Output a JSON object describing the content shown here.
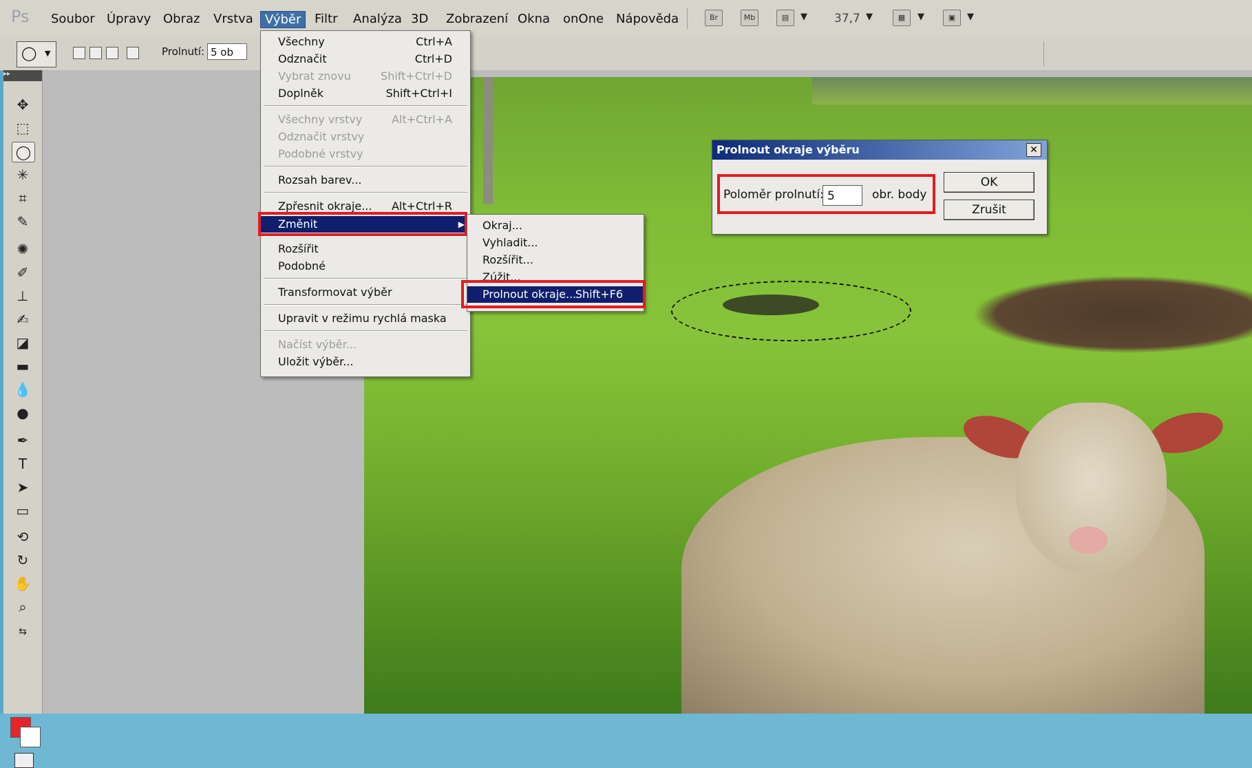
{
  "app": {
    "logo": "Ps"
  },
  "menubar": {
    "items": [
      "Soubor",
      "Úpravy",
      "Obraz",
      "Vrstva",
      "Výběr",
      "Filtr",
      "Analýza",
      "3D",
      "Zobrazení",
      "Okna",
      "onOne",
      "Nápověda"
    ],
    "active": "Výběr",
    "icons": [
      "Br",
      "Mb"
    ],
    "zoom": "37,7"
  },
  "options": {
    "feather_label": "Prolnutí:",
    "feather_value": "5 ob"
  },
  "menu": {
    "items": [
      {
        "label": "Všechny",
        "shortcut": "Ctrl+A"
      },
      {
        "label": "Odznačit",
        "shortcut": "Ctrl+D"
      },
      {
        "label": "Vybrat znovu",
        "shortcut": "Shift+Ctrl+D"
      },
      {
        "label": "Doplněk",
        "shortcut": "Shift+Ctrl+I"
      },
      {
        "label": "Všechny vrstvy",
        "shortcut": "Alt+Ctrl+A"
      },
      {
        "label": "Odznačit vrstvy",
        "shortcut": ""
      },
      {
        "label": "Podobné vrstvy",
        "shortcut": ""
      },
      {
        "label": "Rozsah barev...",
        "shortcut": ""
      },
      {
        "label": "Zpřesnit okraje...",
        "shortcut": "Alt+Ctrl+R"
      },
      {
        "label": "Změnit",
        "shortcut": ""
      },
      {
        "label": "Rozšířit",
        "shortcut": ""
      },
      {
        "label": "Podobné",
        "shortcut": ""
      },
      {
        "label": "Transformovat výběr",
        "shortcut": ""
      },
      {
        "label": "Upravit v režimu rychlá maska",
        "shortcut": ""
      },
      {
        "label": "Načíst výběr...",
        "shortcut": ""
      },
      {
        "label": "Uložit výběr...",
        "shortcut": ""
      }
    ]
  },
  "submenu": {
    "items": [
      {
        "label": "Okraj...",
        "shortcut": ""
      },
      {
        "label": "Vyhladit...",
        "shortcut": ""
      },
      {
        "label": "Rozšířit...",
        "shortcut": ""
      },
      {
        "label": "Zúžit...",
        "shortcut": ""
      },
      {
        "label": "Prolnout okraje...",
        "shortcut": "Shift+F6"
      }
    ]
  },
  "dialog": {
    "title": "Prolnout okraje výběru",
    "close": "✕",
    "radius_label": "Poloměr prolnutí:",
    "radius_value": "5",
    "unit": "obr. body",
    "ok": "OK",
    "cancel": "Zrušit"
  },
  "colors": {
    "foreground": "#e5252a",
    "background": "#ffffff",
    "highlight": "#0f1f6d",
    "annotation": "#e21b23"
  }
}
